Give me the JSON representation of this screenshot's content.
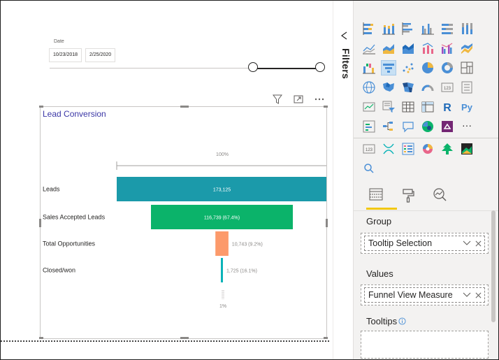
{
  "slicer": {
    "label": "Date",
    "start_date": "10/23/2018",
    "end_date": "2/25/2020"
  },
  "visual": {
    "title": "Lead Conversion"
  },
  "chart_data": {
    "type": "funnel",
    "top_label": "100%",
    "bottom_label": "1%",
    "categories": [
      "Leads",
      "Sales Accepted Leads",
      "Total Opportunities",
      "Closed/won"
    ],
    "values": [
      173125,
      116739,
      10743,
      1725
    ],
    "value_labels": [
      "173,125",
      "116,739 (67.4%)",
      "10,743 (9.2%)",
      "1,725 (16.1%)"
    ],
    "colors": [
      "#1b9aaa",
      "#0bb36a",
      "#fc9a6b",
      "#0bb3b8"
    ]
  },
  "filters": {
    "label": "Filters"
  },
  "fields": {
    "group_label": "Group",
    "group_field": "Tooltip Selection",
    "values_label": "Values",
    "values_field": "Funnel View Measure",
    "tooltips_label": "Tooltips"
  },
  "viz_icons": {
    "row_1": [
      "stacked-bar-icon",
      "stacked-column-icon",
      "clustered-bar-icon",
      "clustered-column-icon",
      "100-stacked-bar-icon",
      "100-stacked-column-icon"
    ],
    "row_2": [
      "line-chart-icon",
      "area-chart-icon",
      "stacked-area-icon",
      "line-column-icon",
      "line-clustered-column-icon",
      "ribbon-chart-icon"
    ],
    "row_3": [
      "waterfall-icon",
      "funnel-icon",
      "scatter-icon",
      "pie-chart-icon",
      "donut-chart-icon",
      "treemap-icon"
    ],
    "row_4": [
      "map-icon",
      "filled-map-icon",
      "shape-map-icon",
      "gauge-icon",
      "card-icon",
      "multi-row-card-icon"
    ],
    "row_5": [
      "kpi-icon",
      "slicer-icon",
      "table-icon",
      "matrix-icon",
      "r-visual-icon",
      "python-visual-icon"
    ],
    "row_6": [
      "key-influencers-icon",
      "decomposition-tree-icon",
      "qa-icon",
      "arcgis-map-icon",
      "power-apps-icon",
      "more-icon"
    ],
    "custom": [
      "custom-card-icon",
      "custom-network-icon",
      "custom-table-icon",
      "custom-donut-icon",
      "custom-tree-icon",
      "custom-layer-icon"
    ],
    "r_text": "R",
    "py_text": "Py",
    "card_text": "123",
    "custom_card_text": "123",
    "more_text": "···"
  },
  "pane_tabs": [
    "fields-tab-icon",
    "format-tab-icon",
    "analytics-tab-icon"
  ],
  "colors": {
    "accent": "#f2c811",
    "title": "#3b37a6"
  }
}
